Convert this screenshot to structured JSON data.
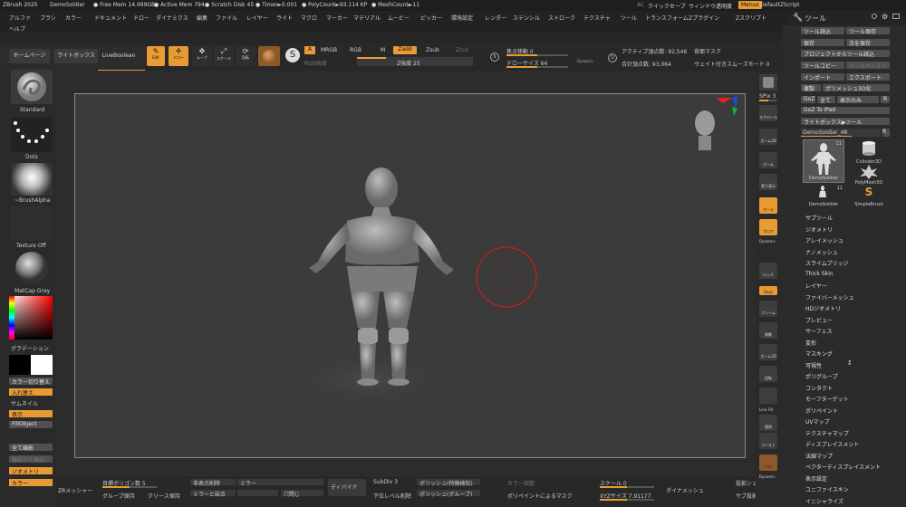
{
  "titlebar": {
    "app": "ZBrush 2025",
    "doc": "DemoSoldier",
    "free_mem": "● Free Mem 14.999GB",
    "active_mem": "● Active Mem 794",
    "scratch": "● Scratch Disk 45",
    "timer": "● Timer►0.001",
    "polycount": "● PolyCount►93.114 KP",
    "meshcount": "● MeshCount►11",
    "ac": "AC",
    "quicksave": "クイックセーブ",
    "window_opacity": "ウィンドウ透明度",
    "menus": "Menus",
    "default_zscript": "DefaultZScript"
  },
  "menus": [
    "アルファ",
    "ブラシ",
    "カラー",
    "ドキュメント",
    "ドロー",
    "ダイナミクス",
    "編集",
    "ファイル",
    "レイヤー",
    "ライト",
    "マクロ",
    "マーカー",
    "マテリアル",
    "ムービー",
    "ピッカー",
    "環境設定",
    "レンダー",
    "ステンシル",
    "ストローク",
    "テクスチャ",
    "ツール",
    "トランスフォーム",
    "Zプラグイン",
    "Zスクリプト"
  ],
  "help": "ヘルプ",
  "palette_title": "ツール",
  "shelf": {
    "home": "ホームページ",
    "lightbox": "ライトボックス",
    "live_boolean": "LiveBoolean"
  },
  "toolbar": {
    "edit": "Edit",
    "draw": "ドロー",
    "move": "ムーブ",
    "scale": "スケール",
    "rotate": "回転",
    "a": "A",
    "mrgb": "MRGB",
    "rgb": "RGB",
    "m": "M",
    "zadd": "Zadd",
    "zsub": "Zsub",
    "zcut": "Zcut",
    "rgb_intensity": "RGB強度",
    "z_intensity": "Z強度 25",
    "focal_shift": "焦点移動 0",
    "draw_size": "ドローサイズ 64",
    "dynamic": "Dynamic",
    "active_points": "アクティブ頂点数: 92,546",
    "total_points": "合計頂点数: 93,064",
    "backface_mask": "背面マスク",
    "smooth_weight": "ウェイト付きスムーズモード 0"
  },
  "left": {
    "standard": "Standard",
    "dots": "Dots",
    "brush_alpha": "~BrushAlpha",
    "texture_off": "Texture Off",
    "matcap": "MatCap Gray",
    "gradient": "グラデーション",
    "switch_color": "カラー切り替え",
    "swap": "入れ替え",
    "thumbnail": "サムネイル",
    "show": "表示",
    "fillobject": "FillObject",
    "all_display": "全て縮影",
    "display_extract": "縮影から抽出",
    "geometry": "ジオメトリ",
    "color": "カラー"
  },
  "right_shelf": {
    "spix": "SPix 3",
    "a1": "スクロール",
    "a2": "ズーム3D",
    "a3": "ズーム",
    "a4": "実寸表示",
    "a5": "ポーズ",
    "a6": "フロア",
    "dynamic": "Dynamic",
    "a7": "ロック",
    "a8": "Qxyz",
    "a9": "フレーム",
    "a10": "移動",
    "a11": "ズーム3D",
    "a12": "回転",
    "line_fill": "Line Fill",
    "a13": "透明",
    "a14": "ゴースト",
    "a15": "ソロ",
    "dynamic2": "Dynamic"
  },
  "tool_palette": {
    "load_tool": "ツール読込",
    "save_as": "ツール保存",
    "save": "保存",
    "save_as2": "次を保存",
    "copy_proj": "プロジェクトからツール読込",
    "copy_tool": "ツールコピー",
    "paste_tool": "ツールペースト",
    "import": "インポート",
    "export": "エクスポート",
    "clone": "複製",
    "make_polymesh": "ポリメッシュ3D化",
    "goz": "GoZ",
    "all": "全て",
    "visible": "表示のみ",
    "r": "R",
    "goz_ipad": "GoZ To iPad",
    "lightbox_tool": "ライトボックス▶ツール",
    "current_tool": "DemoSoldier_48",
    "tool_r": "R",
    "thumbs": [
      {
        "name": "DemoSoldier",
        "badge": "11"
      },
      {
        "name": "Cylinder3D",
        "badge": ""
      },
      {
        "name": "DemoSoldier",
        "badge": "11"
      },
      {
        "name": "PolyMesh3D",
        "badge": ""
      },
      {
        "name": "SimpleBrush",
        "badge": ""
      }
    ],
    "subpalettes": [
      "サブツール",
      "ジオメトリ",
      "アレイメッシュ",
      "ナノメッシュ",
      "スライムブリッジ",
      "Thick Skin",
      "レイヤー",
      "ファイバーメッシュ",
      "HDジオメトリ",
      "プレビュー",
      "サーフェス",
      "変形",
      "マスキング",
      "可視性",
      "ポリグループ",
      "コンタクト",
      "モーフターゲット",
      "ポリペイント",
      "UVマップ",
      "テクスチャマップ",
      "ディスプレイスメント",
      "法線マップ",
      "ベクターディスプレイスメント",
      "表示設定",
      "ユニファイスキン",
      "イニシャライズ"
    ]
  },
  "bottom": {
    "zremesher": "ZRメッシャー",
    "target_poly": "目標ポリゴン数 5",
    "half": "半分",
    "group_keep": "グループ保持",
    "crease_keep": "クリース保持",
    "detect_edge": "非表示削除",
    "mirror_weld": "ミラーと結合",
    "mirror": "ミラー",
    "close_holes": "穴閉じ",
    "divide": "ディバイド",
    "subdiv": "SubDiv 3",
    "lower_levels": "下位レベル削除",
    "polish_crisp": "ポリッシュ(特徴検知)",
    "polish_groups": "ポリッシュ(グループ)",
    "polypaint_mask": "ポリペイントによるマスク",
    "color_adjust": "カラー調整",
    "scale": "スケール 0",
    "xyz_size": "XYZサイズ 7.91177",
    "dynamesh": "ダイナメッシュ",
    "sub_proj": "サブ投影",
    "proj_shell": "投影シェル"
  },
  "colors": {
    "accent": "#e89b35",
    "viewport": "#3b3b3b",
    "panel": "#2a2a2a",
    "brush_circle": "#b22222"
  }
}
